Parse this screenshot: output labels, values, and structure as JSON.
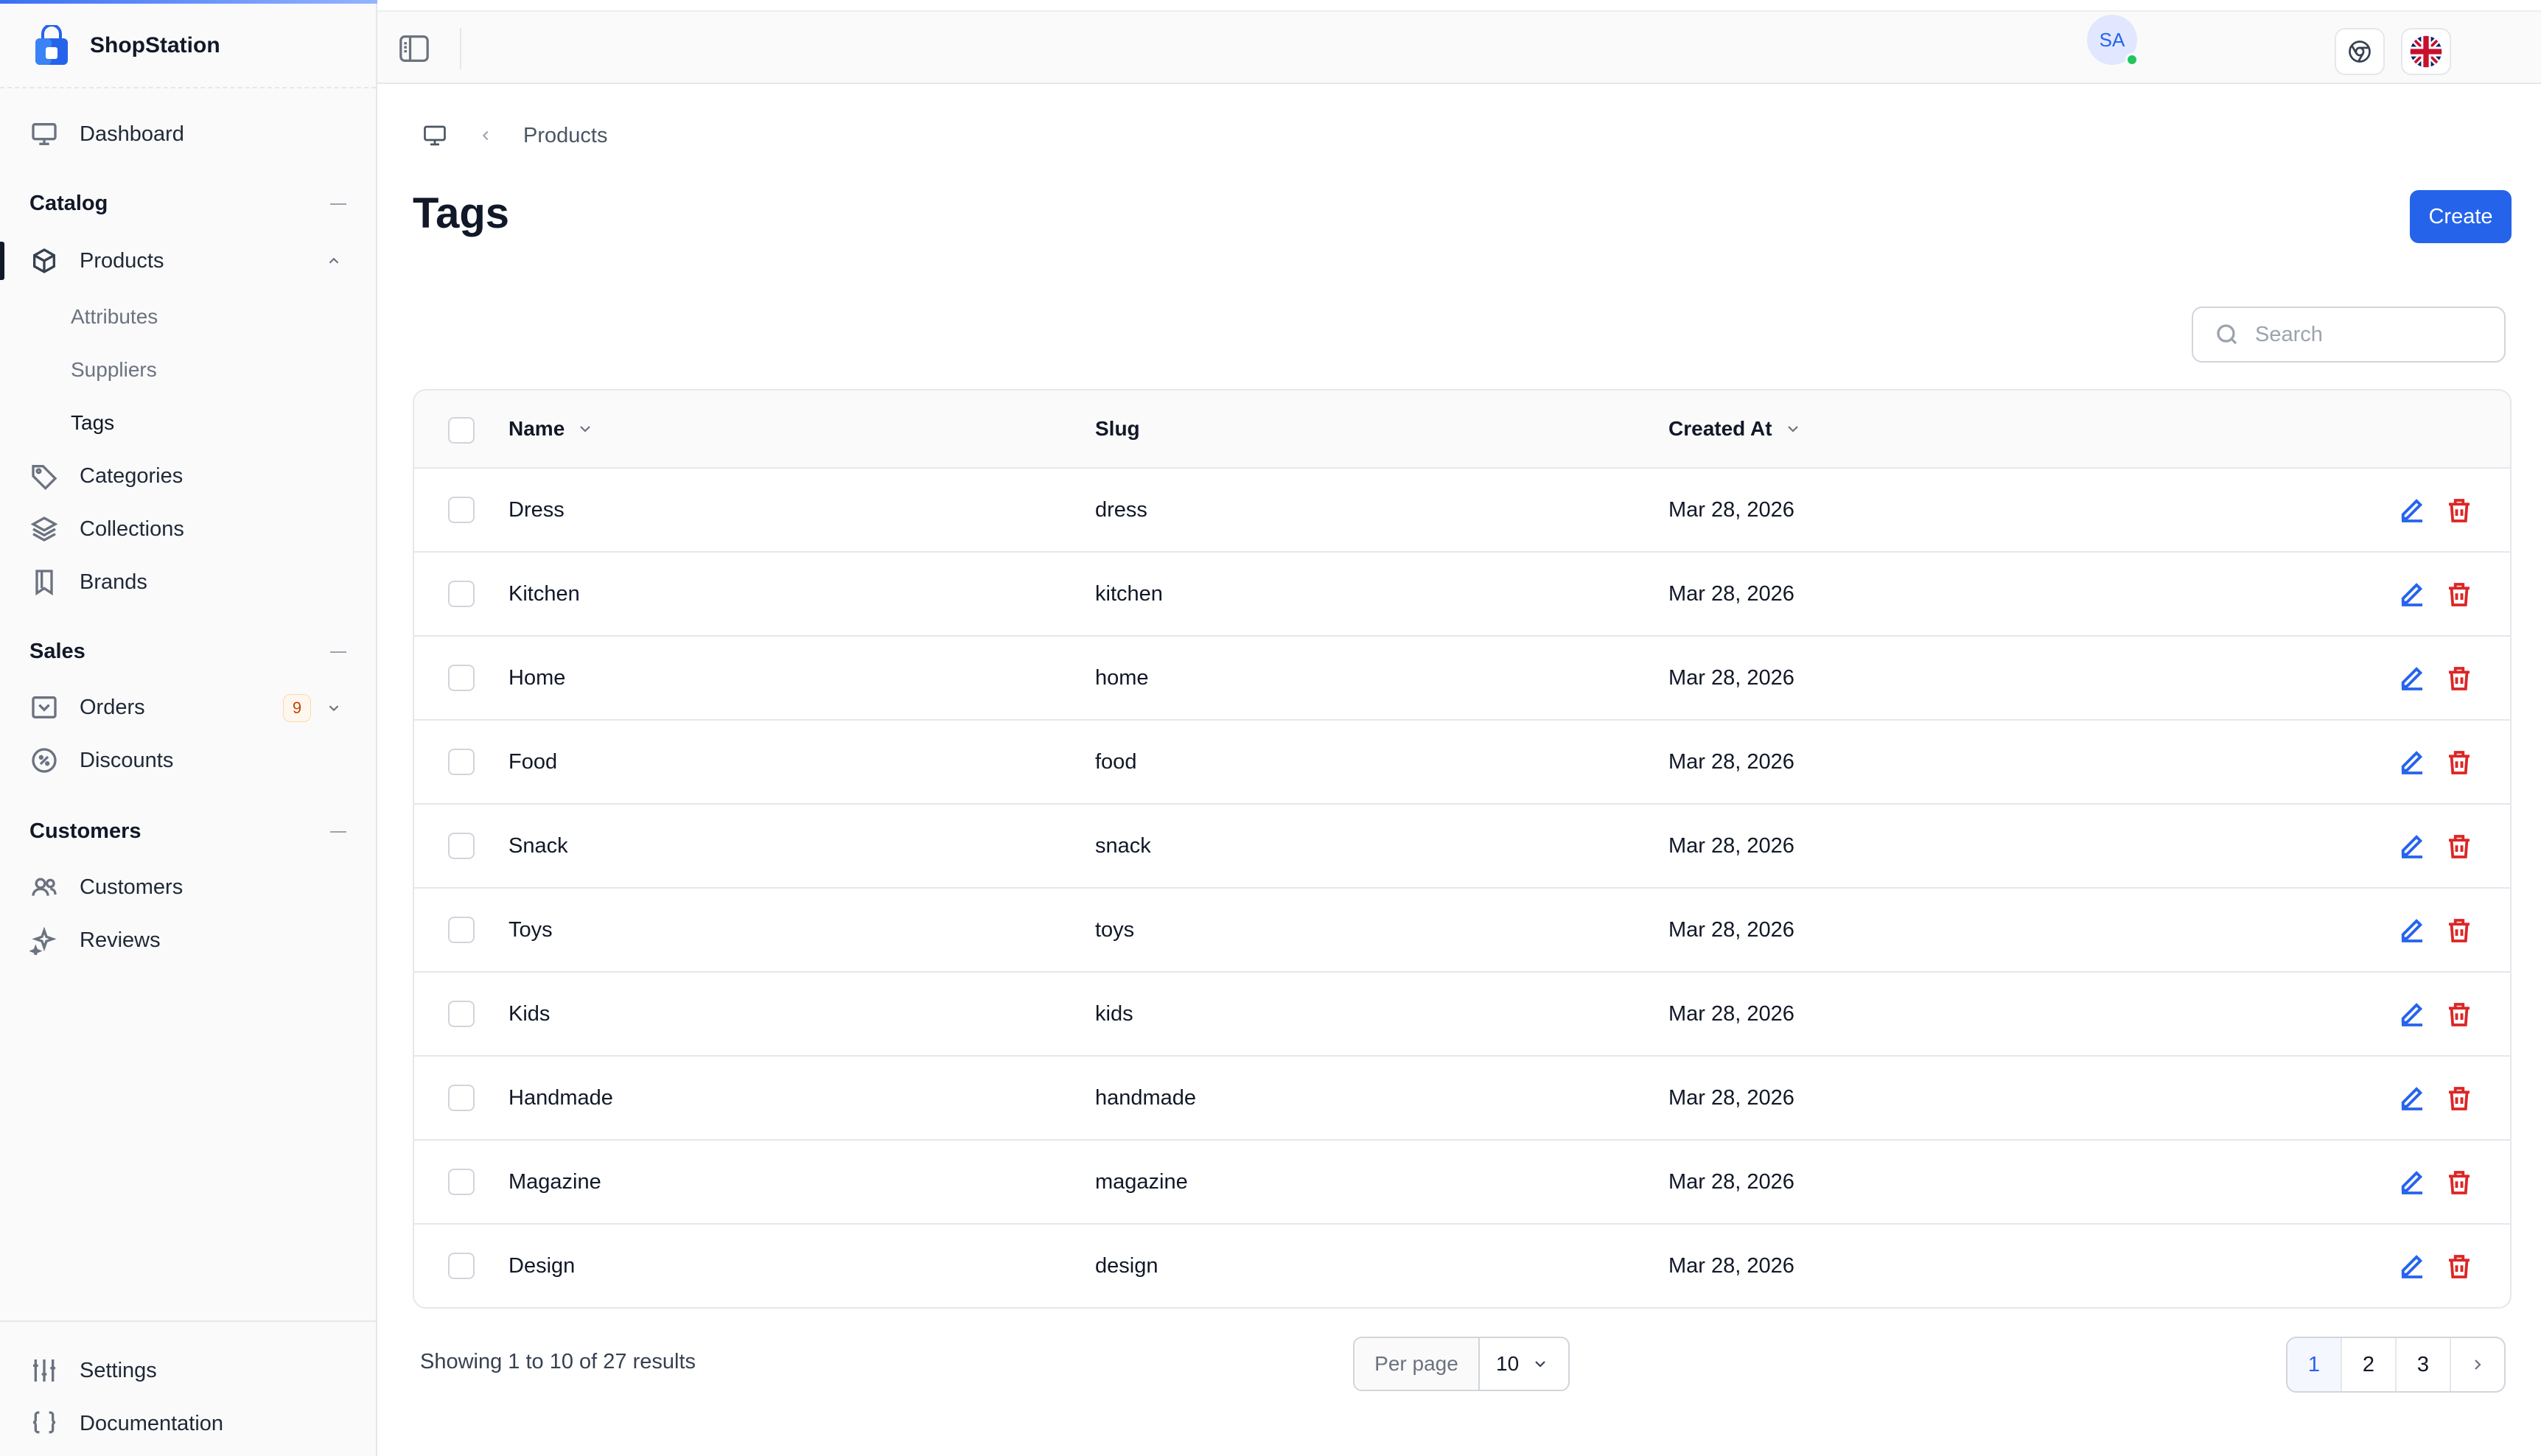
{
  "app": {
    "name": "ShopStation"
  },
  "sidebar": {
    "dashboard": "Dashboard",
    "sections": {
      "catalog": "Catalog",
      "sales": "Sales",
      "customers": "Customers"
    },
    "catalog_items": {
      "products": "Products",
      "attributes": "Attributes",
      "suppliers": "Suppliers",
      "tags": "Tags",
      "categories": "Categories",
      "collections": "Collections",
      "brands": "Brands"
    },
    "sales_items": {
      "orders": "Orders",
      "orders_badge": "9",
      "discounts": "Discounts"
    },
    "customer_items": {
      "customers": "Customers",
      "reviews": "Reviews"
    },
    "bottom": {
      "settings": "Settings",
      "documentation": "Documentation"
    }
  },
  "topbar": {
    "avatar_initials": "SA"
  },
  "breadcrumb": {
    "current": "Products"
  },
  "page": {
    "title": "Tags",
    "create_label": "Create"
  },
  "search": {
    "placeholder": "Search",
    "value": ""
  },
  "table": {
    "headers": {
      "name": "Name",
      "slug": "Slug",
      "created_at": "Created At"
    },
    "rows": [
      {
        "name": "Dress",
        "slug": "dress",
        "created_at": "Mar 28, 2026"
      },
      {
        "name": "Kitchen",
        "slug": "kitchen",
        "created_at": "Mar 28, 2026"
      },
      {
        "name": "Home",
        "slug": "home",
        "created_at": "Mar 28, 2026"
      },
      {
        "name": "Food",
        "slug": "food",
        "created_at": "Mar 28, 2026"
      },
      {
        "name": "Snack",
        "slug": "snack",
        "created_at": "Mar 28, 2026"
      },
      {
        "name": "Toys",
        "slug": "toys",
        "created_at": "Mar 28, 2026"
      },
      {
        "name": "Kids",
        "slug": "kids",
        "created_at": "Mar 28, 2026"
      },
      {
        "name": "Handmade",
        "slug": "handmade",
        "created_at": "Mar 28, 2026"
      },
      {
        "name": "Magazine",
        "slug": "magazine",
        "created_at": "Mar 28, 2026"
      },
      {
        "name": "Design",
        "slug": "design",
        "created_at": "Mar 28, 2026"
      }
    ]
  },
  "footer": {
    "summary": "Showing 1 to 10 of 27 results",
    "per_page_label": "Per page",
    "per_page_value": "10",
    "pages": [
      "1",
      "2",
      "3"
    ],
    "current_page": "1"
  },
  "colors": {
    "primary": "#2563eb",
    "danger": "#dc2626",
    "badge": "#c2410c",
    "status_online": "#22c55e"
  }
}
